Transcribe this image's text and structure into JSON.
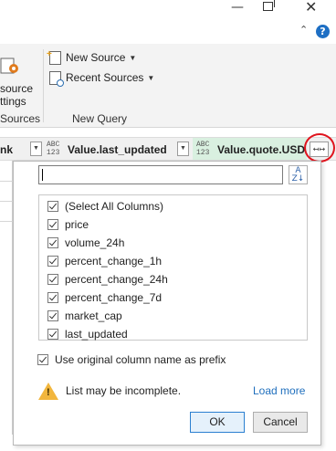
{
  "window_controls": {
    "minimize": "—",
    "close": "✕",
    "collapse_chevron": "⌃",
    "help": "?"
  },
  "ribbon": {
    "data_source_label_line1": "source",
    "data_source_label_line2": "ttings",
    "group_sources": "Sources",
    "new_source": "New Source",
    "recent_sources": "Recent Sources",
    "group_new_query": "New Query"
  },
  "column_headers": {
    "col1_partial": "nk",
    "col2_type": "ABC\n123",
    "col2_name": "Value.last_updated",
    "col3_type": "ABC\n123",
    "col3_name": "Value.quote.USD",
    "expand_icon": "↤↦"
  },
  "expand_panel": {
    "search_value": "",
    "sort_icon": "A↓Z",
    "columns": [
      {
        "label": "(Select All Columns)",
        "checked": true
      },
      {
        "label": "price",
        "checked": true
      },
      {
        "label": "volume_24h",
        "checked": true
      },
      {
        "label": "percent_change_1h",
        "checked": true
      },
      {
        "label": "percent_change_24h",
        "checked": true
      },
      {
        "label": "percent_change_7d",
        "checked": true
      },
      {
        "label": "market_cap",
        "checked": true
      },
      {
        "label": "last_updated",
        "checked": true
      }
    ],
    "prefix_label": "Use original column name as prefix",
    "prefix_checked": true,
    "warning_text": "List may be incomplete.",
    "load_more": "Load more",
    "ok": "OK",
    "cancel": "Cancel"
  },
  "colors": {
    "highlight_circle": "#e0141e",
    "header_green": "#d9f0e0",
    "link": "#1f6fbd",
    "warning": "#f2b63d"
  }
}
